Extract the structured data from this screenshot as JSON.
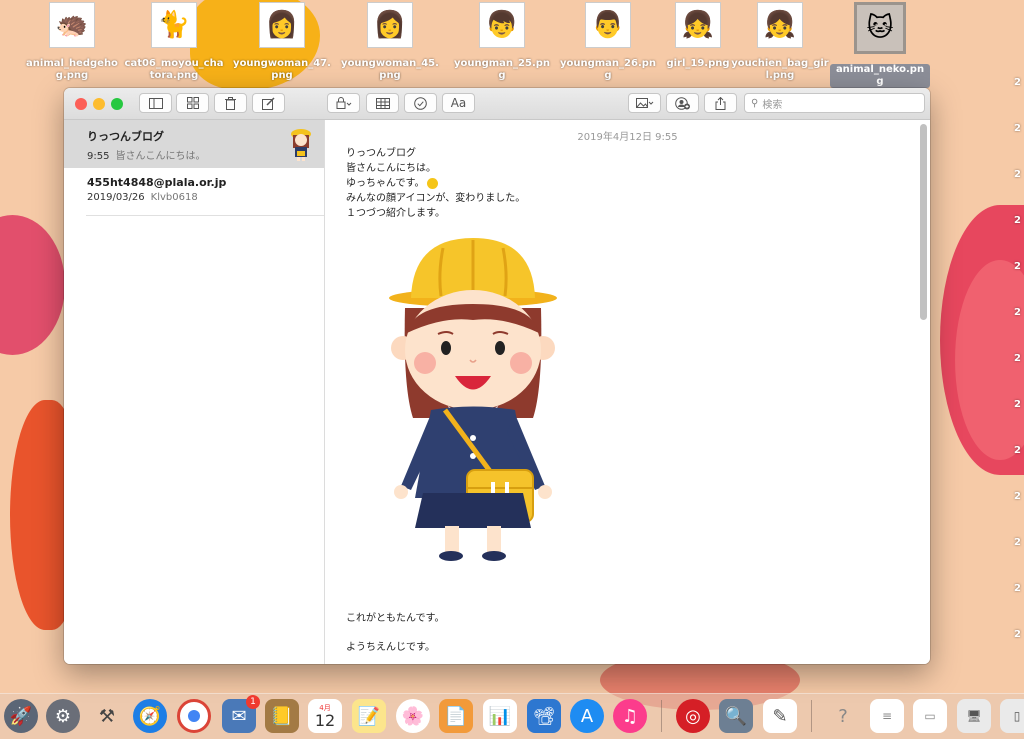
{
  "desktop": {
    "icons": [
      {
        "label": "animal_hedgehog.png",
        "icon": "hedgehog-icon",
        "glyph": "🦔"
      },
      {
        "label": "cat06_moyou_chatora.png",
        "icon": "cat-icon",
        "glyph": "🐈"
      },
      {
        "label": "youngwoman_47.png",
        "icon": "woman-icon",
        "glyph": "👩"
      },
      {
        "label": "youngwoman_45.png",
        "icon": "woman-icon",
        "glyph": "👩"
      },
      {
        "label": "youngman_25.png",
        "icon": "man-icon",
        "glyph": "👦"
      },
      {
        "label": "youngman_26.png",
        "icon": "man-icon",
        "glyph": "👨"
      },
      {
        "label": "girl_19.png",
        "icon": "girl-icon",
        "glyph": "👧"
      },
      {
        "label": "youchien_bag_girl.png",
        "icon": "kindergarten-girl-icon",
        "glyph": "👧"
      },
      {
        "label": "animal_neko.png",
        "icon": "cat-face-icon",
        "glyph": "🐱",
        "selected": true
      }
    ],
    "right_edge_digits": [
      "2",
      "2",
      "2",
      "2",
      "2",
      "2",
      "2",
      "2",
      "2",
      "2",
      "2",
      "2",
      "2"
    ]
  },
  "window": {
    "toolbar": {
      "search_placeholder": "検索",
      "format_label": "Aa"
    },
    "notes": [
      {
        "title": "りっつんブログ",
        "time": "9:55",
        "preview": "皆さんこんにちは。",
        "selected": true
      },
      {
        "title": "455ht4848@plala.or.jp",
        "time": "2019/03/26",
        "preview": "Klvb0618",
        "selected": false
      }
    ],
    "content": {
      "date": "2019年4月12日 9:55",
      "lines": [
        "りっつんブログ",
        "皆さんこんにちは。",
        "ゆっちゃんです。",
        "みんなの顔アイコンが、変わりました。",
        "１つづつ紹介します。"
      ],
      "bottom_line_1": "これがともたんです。",
      "bottom_line_2": "ようちえんじです。"
    }
  },
  "dock": {
    "calendar_month": "4月",
    "calendar_day": "12",
    "mail_badge": "1"
  }
}
